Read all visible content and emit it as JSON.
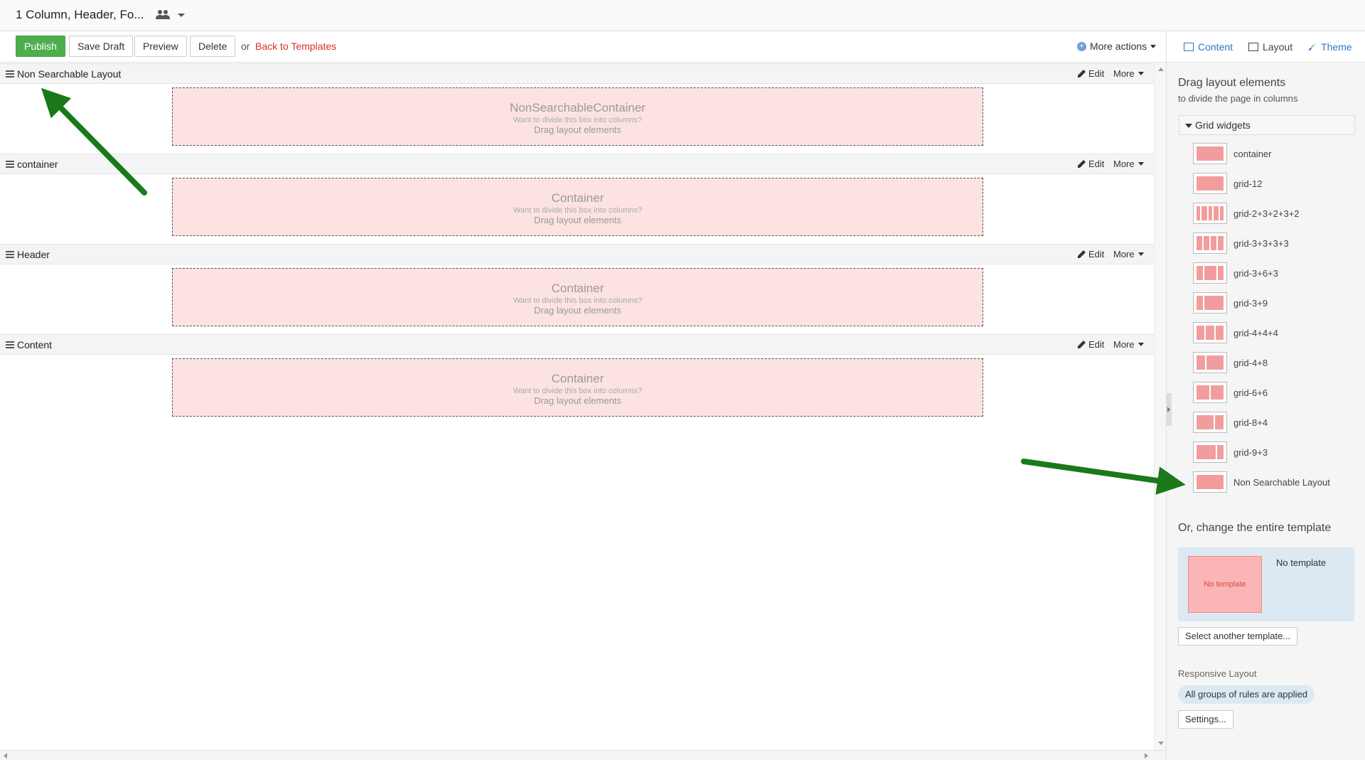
{
  "window": {
    "title": "1 Column, Header, Fo..."
  },
  "toolbar": {
    "publish": "Publish",
    "save_draft": "Save Draft",
    "preview": "Preview",
    "delete": "Delete",
    "or": "or",
    "back": "Back to Templates",
    "more_actions": "More actions"
  },
  "tabs": {
    "content": "Content",
    "layout": "Layout",
    "theme": "Theme"
  },
  "sections": [
    {
      "label": "Non Searchable Layout",
      "box_title": "NonSearchableContainer",
      "box_hint": "Want to divide this box into columns?",
      "box_drag": "Drag layout elements",
      "edit": "Edit",
      "more": "More"
    },
    {
      "label": "container",
      "box_title": "Container",
      "box_hint": "Want to divide this box into columns?",
      "box_drag": "Drag layout elements",
      "edit": "Edit",
      "more": "More"
    },
    {
      "label": "Header",
      "box_title": "Container",
      "box_hint": "Want to divide this box into columns?",
      "box_drag": "Drag layout elements",
      "edit": "Edit",
      "more": "More"
    },
    {
      "label": "Content",
      "box_title": "Container",
      "box_hint": "Want to divide this box into columns?",
      "box_drag": "Drag layout elements",
      "edit": "Edit",
      "more": "More"
    }
  ],
  "panel": {
    "heading": "Drag layout elements",
    "subheading": "to divide the page in columns",
    "group_label": "Grid widgets",
    "widgets": [
      {
        "name": "container",
        "cols": [
          12
        ]
      },
      {
        "name": "grid-12",
        "cols": [
          12
        ]
      },
      {
        "name": "grid-2+3+2+3+2",
        "cols": [
          2,
          3,
          2,
          3,
          2
        ]
      },
      {
        "name": "grid-3+3+3+3",
        "cols": [
          3,
          3,
          3,
          3
        ]
      },
      {
        "name": "grid-3+6+3",
        "cols": [
          3,
          6,
          3
        ]
      },
      {
        "name": "grid-3+9",
        "cols": [
          3,
          9
        ]
      },
      {
        "name": "grid-4+4+4",
        "cols": [
          4,
          4,
          4
        ]
      },
      {
        "name": "grid-4+8",
        "cols": [
          4,
          8
        ]
      },
      {
        "name": "grid-6+6",
        "cols": [
          6,
          6
        ]
      },
      {
        "name": "grid-8+4",
        "cols": [
          8,
          4
        ]
      },
      {
        "name": "grid-9+3",
        "cols": [
          9,
          3
        ]
      },
      {
        "name": "Non Searchable Layout",
        "cols": [
          12
        ]
      }
    ],
    "template_heading": "Or, change the entire template",
    "template_preview": "No template",
    "template_name": "No template",
    "select_template": "Select another template...",
    "responsive_label": "Responsive Layout",
    "responsive_pill": "All groups of rules are applied",
    "settings": "Settings..."
  },
  "colors": {
    "primary": "#4cae4c",
    "link": "#d9302a",
    "accent": "#2e78c7",
    "dropzone": "#fde2e2",
    "arrow": "#1a7a1a"
  }
}
